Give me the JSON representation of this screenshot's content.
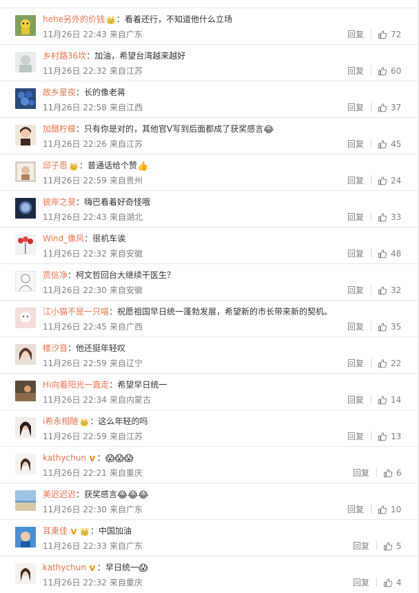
{
  "reply_label": "回复",
  "colors": {
    "username": "#eb7350",
    "text": "#333333",
    "meta": "#808080",
    "divider": "#e6e6e6"
  },
  "comments": [
    {
      "user": "hehe另外的价钱",
      "badge": "crown",
      "text": "看着还行，不知道他什么立场",
      "emoji": "",
      "time": "11月26日 22:43",
      "from": "来自广东",
      "likes": "72"
    },
    {
      "user": "乡村路36坎",
      "badge": "",
      "text": "加油，希望台湾越来越好",
      "emoji": "",
      "time": "11月26日 22:32",
      "from": "来自江苏",
      "likes": "60"
    },
    {
      "user": "故乡星夜",
      "badge": "",
      "text": "长的像老蒋",
      "emoji": "",
      "time": "11月26日 22:58",
      "from": "来自江西",
      "likes": "37"
    },
    {
      "user": "加醋柠檬",
      "badge": "",
      "text": "只有你是对的，其他官V写到后面都成了获奖感言",
      "emoji": "😂",
      "time": "11月26日 22:26",
      "from": "来自江苏",
      "likes": "45"
    },
    {
      "user": "邱子恩",
      "badge": "crown",
      "text": "普通话给个赞",
      "emoji": "👍",
      "time": "11月26日 22:59",
      "from": "来自贵州",
      "likes": "24"
    },
    {
      "user": "彼岸之旻",
      "badge": "",
      "text": "嗨巴看着好奇怪哦",
      "emoji": "",
      "time": "11月26日 22:43",
      "from": "来自湖北",
      "likes": "33"
    },
    {
      "user": "Wind_像风",
      "badge": "",
      "text": "很机车诶",
      "emoji": "",
      "time": "11月26日 22:32",
      "from": "来自安徽",
      "likes": "48"
    },
    {
      "user": "贾信净",
      "badge": "",
      "text": "柯文哲回台大继续干医生？",
      "emoji": "",
      "time": "11月26日 22:30",
      "from": "来自安徽",
      "likes": "32"
    },
    {
      "user": "江小猫不是一只喵",
      "badge": "",
      "text": "祝愿祖国早日统一蓬勃发展，希望新的市长带来新的契机。",
      "emoji": "",
      "time": "11月26日 22:45",
      "from": "来自广西",
      "likes": "35"
    },
    {
      "user": "楼汐音",
      "badge": "",
      "text": "他还挺年轻叹",
      "emoji": "",
      "time": "11月26日 22:59",
      "from": "来自辽宁",
      "likes": "22"
    },
    {
      "user": "Hi向着阳光一直走",
      "badge": "",
      "text": "希望早日统一",
      "emoji": "",
      "time": "11月26日 22:34",
      "from": "来自内蒙古",
      "likes": "14"
    },
    {
      "user": "i希永相随",
      "badge": "crown",
      "text": "这么年轻的吗",
      "emoji": "",
      "time": "11月26日 22:59",
      "from": "来自江苏",
      "likes": "13"
    },
    {
      "user": "kathychun",
      "badge": "v",
      "text": "",
      "emoji": "😱😱😱",
      "time": "11月26日 22:21",
      "from": "来自重庆",
      "likes": "6"
    },
    {
      "user": "美迟迟迟",
      "badge": "",
      "text": "获奖感言",
      "emoji": "😂😂😂",
      "time": "11月26日 22:30",
      "from": "来自广东",
      "likes": "10"
    },
    {
      "user": "耳東佳",
      "badge": "v-crown",
      "text": "中国加油",
      "emoji": "",
      "time": "11月26日 22:33",
      "from": "来自广东",
      "likes": "5"
    },
    {
      "user": "kathychun",
      "badge": "v",
      "text": "早日统一",
      "emoji": "😱",
      "time": "11月26日 22:32",
      "from": "来自重庆",
      "likes": "4"
    }
  ]
}
